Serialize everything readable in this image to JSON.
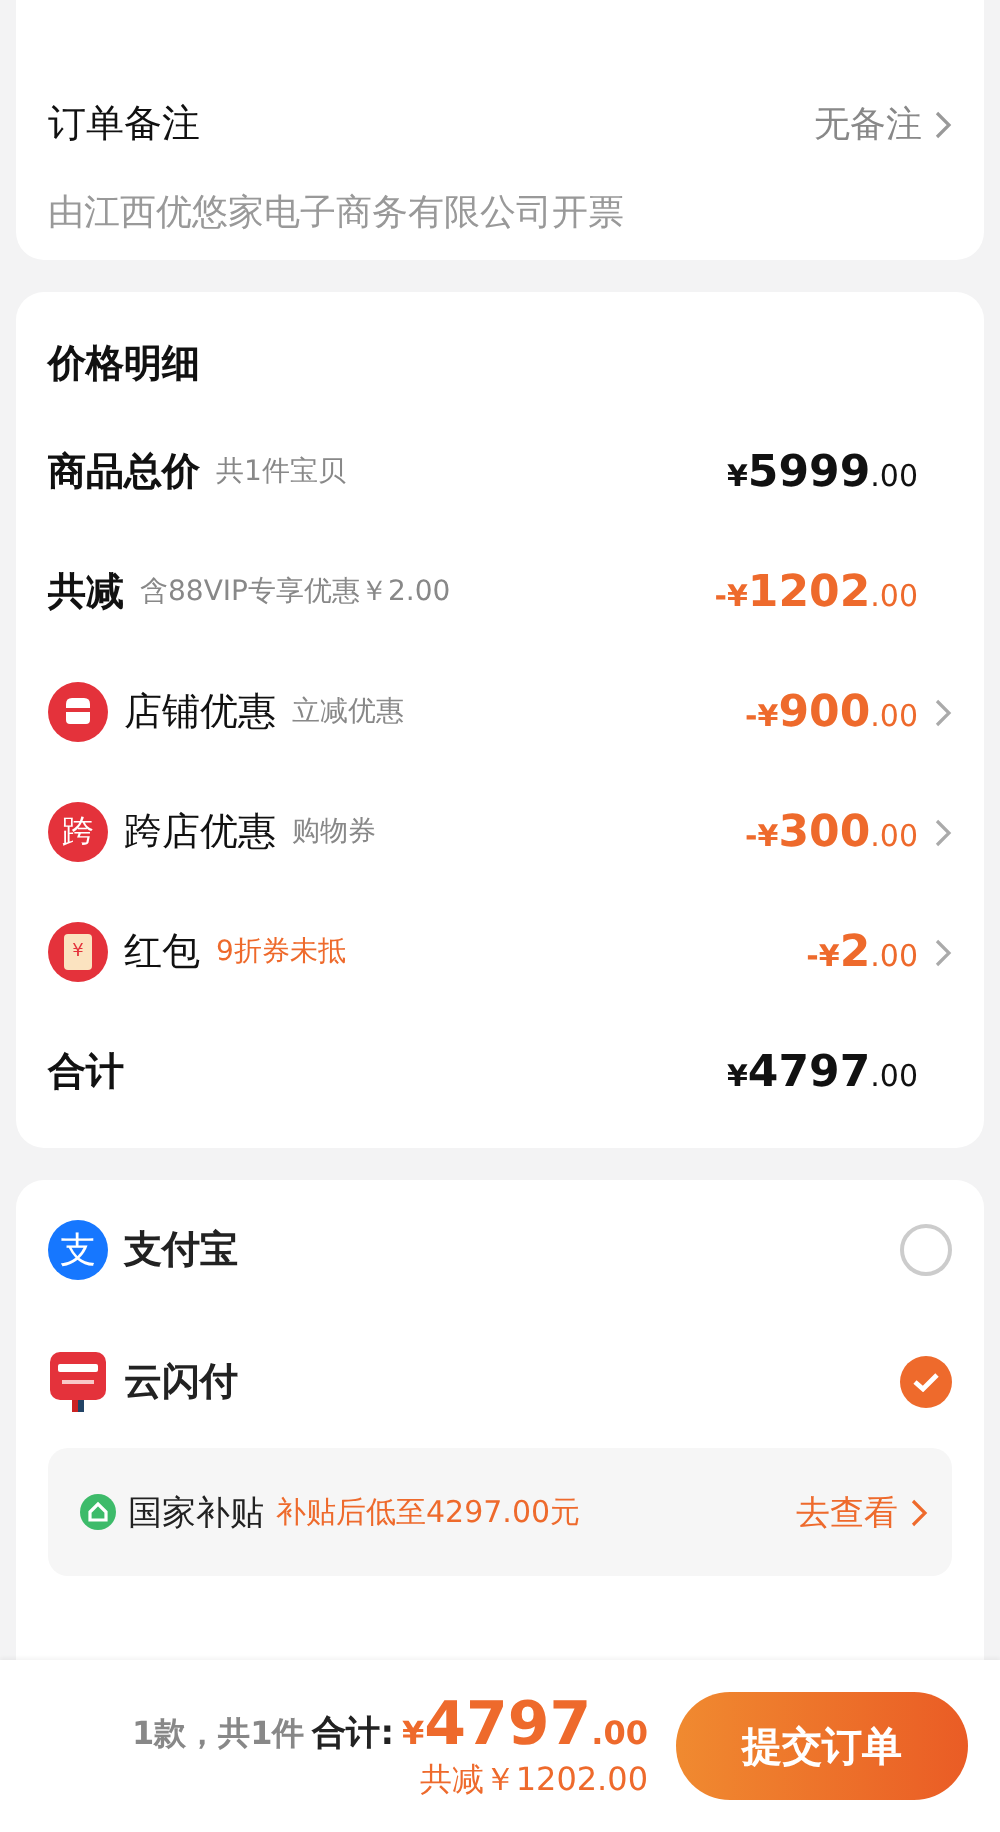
{
  "remark_card": {
    "label": "订单备注",
    "value": "无备注",
    "invoice": "由江西优悠家电子商务有限公司开票"
  },
  "price_card": {
    "title": "价格明细",
    "rows": [
      {
        "kind": "summary",
        "label": "商品总价",
        "note": "共1件宝贝",
        "note_highlight": false,
        "deduction": false,
        "arrow": false,
        "prefix": "¥",
        "main": "5999",
        "cents": ".00"
      },
      {
        "kind": "summary",
        "label": "共减",
        "note": "含88VIP专享优惠￥2.00",
        "note_highlight": false,
        "deduction": true,
        "arrow": false,
        "prefix": "-¥",
        "main": "1202",
        "cents": ".00"
      },
      {
        "kind": "discount",
        "label": "店铺优惠",
        "note": "立减优惠",
        "note_highlight": false,
        "deduction": true,
        "arrow": true,
        "prefix": "-¥",
        "main": "900",
        "cents": ".00"
      },
      {
        "kind": "discount",
        "icon_text": "跨",
        "label": "跨店优惠",
        "note": "购物券",
        "note_highlight": false,
        "deduction": true,
        "arrow": true,
        "prefix": "-¥",
        "main": "300",
        "cents": ".00"
      },
      {
        "kind": "discount",
        "icon_text": "¥",
        "label": "红包",
        "note": "9折券未抵",
        "note_highlight": true,
        "deduction": true,
        "arrow": true,
        "prefix": "-¥",
        "main": "2",
        "cents": ".00"
      },
      {
        "kind": "summary",
        "label": "合计",
        "deduction": false,
        "arrow": false,
        "prefix": "¥",
        "main": "4797",
        "cents": ".00"
      }
    ]
  },
  "payment": [
    {
      "icon_text": "支",
      "label": "支付宝",
      "selected": false
    },
    {
      "label": "云闪付",
      "selected": true,
      "subsidy": {
        "label": "国家补贴",
        "note": "补贴后低至4297.00元",
        "link": "去查看"
      }
    }
  ],
  "footer": {
    "count": "1款，共1件",
    "total_label": "合计:",
    "currency": "¥",
    "main": "4797",
    "cents": ".00",
    "saved": "共减￥1202.00",
    "submit": "提交订单"
  }
}
